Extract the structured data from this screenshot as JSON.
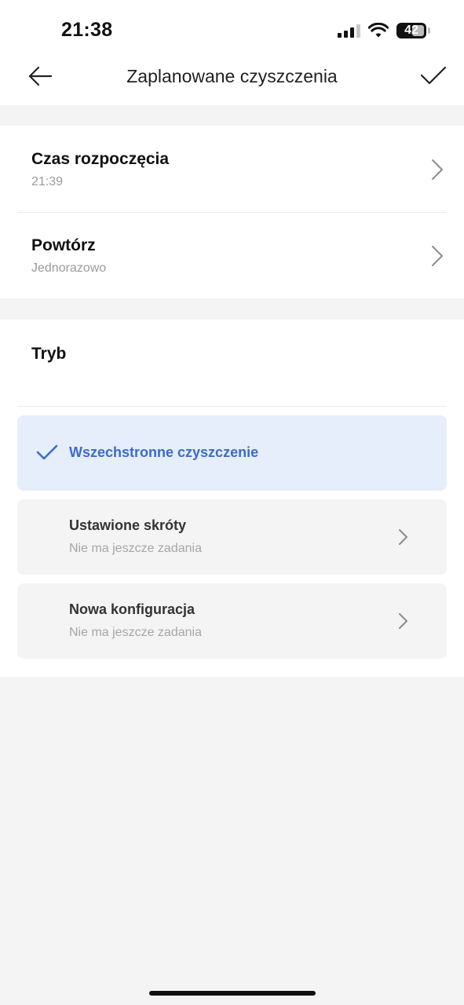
{
  "status_bar": {
    "time": "21:38",
    "battery_level": "42"
  },
  "header": {
    "title": "Zaplanowane czyszczenia",
    "back_icon": "arrow-left-icon",
    "confirm_icon": "checkmark-icon"
  },
  "schedule": {
    "start_time": {
      "label": "Czas rozpoczęcia",
      "value": "21:39"
    },
    "repeat": {
      "label": "Powtórz",
      "value": "Jednorazowo"
    }
  },
  "mode": {
    "title": "Tryb",
    "options": [
      {
        "label": "Wszechstronne czyszczenie",
        "selected": true
      },
      {
        "label": "Ustawione skróty",
        "sub": "Nie ma jeszcze zadania",
        "selected": false
      },
      {
        "label": "Nowa konfiguracja",
        "sub": "Nie ma jeszcze zadania",
        "selected": false
      }
    ]
  },
  "colors": {
    "accent": "#3a6cc9",
    "selected_background": "#e6edfb",
    "page_background": "#f4f4f4"
  }
}
